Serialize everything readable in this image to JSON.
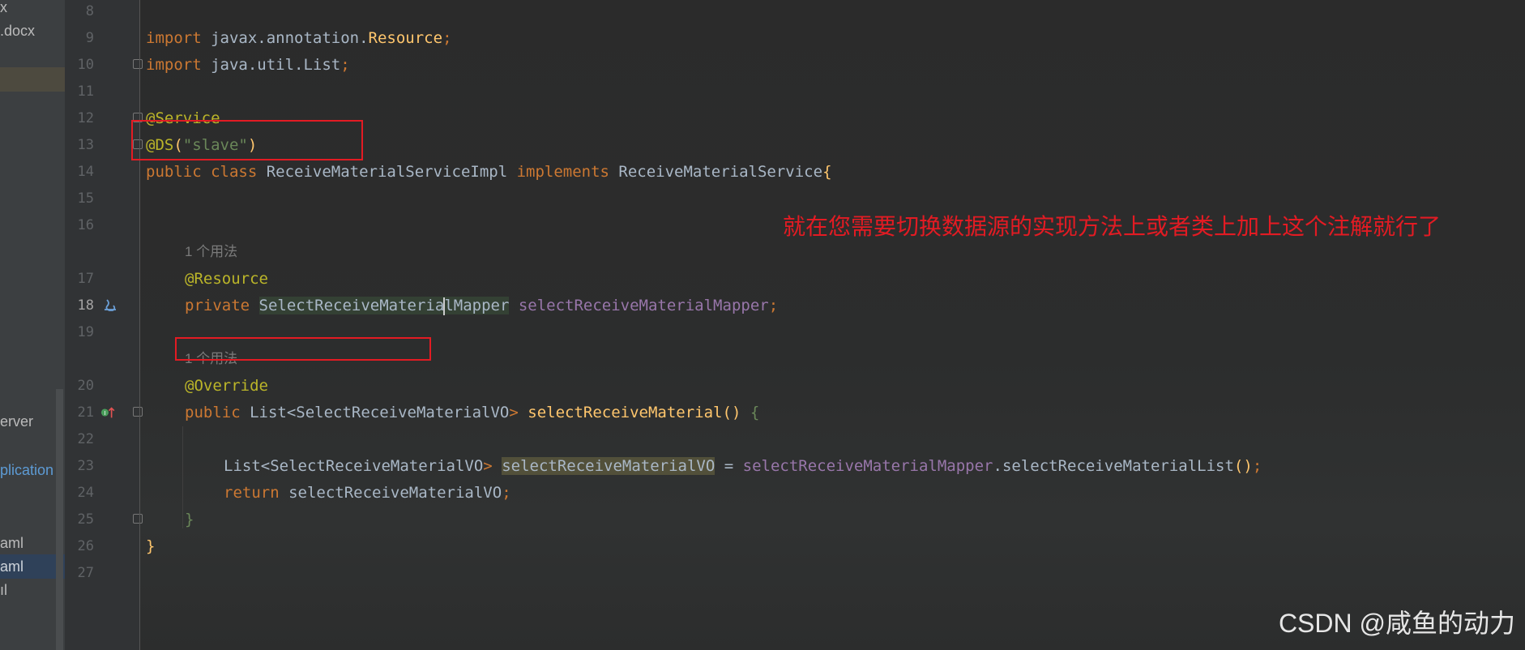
{
  "sidebar": {
    "items": [
      {
        "label": "x"
      },
      {
        "label": ".docx"
      },
      {
        "label": "erver"
      },
      {
        "label": "plication"
      },
      {
        "label": "aml"
      },
      {
        "label": "aml"
      },
      {
        "label": "ıl"
      }
    ]
  },
  "editor": {
    "line_numbers": [
      "8",
      "9",
      "10",
      "11",
      "12",
      "13",
      "14",
      "15",
      "16",
      "17",
      "18",
      "19",
      "20",
      "21",
      "22",
      "23",
      "24",
      "25",
      "26",
      "27"
    ],
    "current_line": "18",
    "usage_hint_1": "1 个用法",
    "usage_hint_2": "1 个用法",
    "code": {
      "l9": {
        "kw": "import",
        "pkg": " javax.annotation.",
        "cls": "Resource",
        "semi": ";"
      },
      "l10": {
        "kw": "import",
        "rest": " java.util.List",
        "semi": ";"
      },
      "l12": {
        "ann": "@Service"
      },
      "l13": {
        "ann": "@DS",
        "open": "(",
        "str": "\"slave\"",
        "close": ")"
      },
      "l14": {
        "kw1": "public class",
        "cls": " ReceiveMaterialServiceImpl ",
        "kw2": "implements",
        "iface": " ReceiveMaterialService",
        "brace": "{"
      },
      "l17": {
        "ann": "@Resource"
      },
      "l18": {
        "kw": "private",
        "type_a": "SelectReceiveMateria",
        "type_b": "lMapper",
        "field": "selectReceiveMaterialMapper",
        "semi": ";"
      },
      "l20": {
        "ann": "@Override"
      },
      "l21": {
        "kw": "public",
        "ret_a": " List<SelectReceiveMaterialVO",
        "ret_b": ">",
        "method": " selectReceiveMaterial",
        "parens": "()",
        "brace": " {"
      },
      "l23": {
        "type_a": "List<SelectReceiveMaterialVO",
        "type_b": ">",
        "var": "selectReceiveMaterialVO",
        "eq": " = ",
        "field": "selectReceiveMaterialMapper",
        "call": ".selectReceiveMaterialList",
        "parens": "()",
        "semi": ";"
      },
      "l24": {
        "kw": "return",
        "var": " selectReceiveMaterialVO",
        "semi": ";"
      },
      "l25": {
        "brace": "}"
      },
      "l26": {
        "brace": "}"
      }
    }
  },
  "annotation_text": "就在您需要切换数据源的实现方法上或者类上加上这个注解就行了",
  "watermark": "CSDN @咸鱼的动力",
  "colors": {
    "background": "#2b2b2b",
    "keyword": "#cc7832",
    "annotation": "#bbb529",
    "string": "#6a8759",
    "field": "#9876aa",
    "method": "#ffc66d",
    "annotation_red": "#e31b23"
  }
}
